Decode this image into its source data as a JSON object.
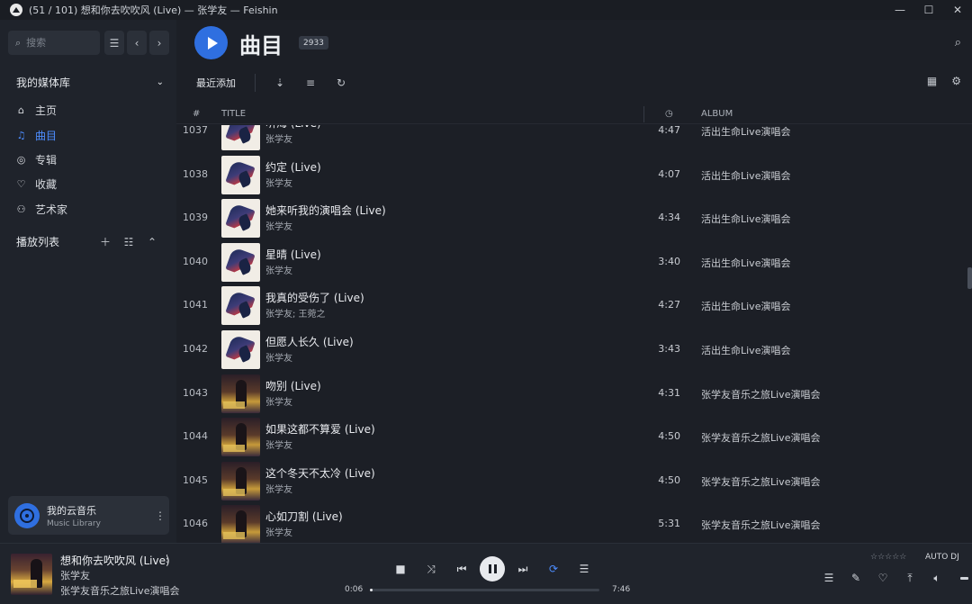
{
  "window": {
    "title": "(51 / 101) 想和你去吹吹风 (Live) — 张学友 — Feishin",
    "controls": [
      "—",
      "☐",
      "✕"
    ]
  },
  "sidebar": {
    "search_placeholder": "搜索",
    "library_header": "我的媒体库",
    "nav": [
      {
        "label": "主页",
        "icon": "home-icon",
        "glyph": "⌂",
        "active": false
      },
      {
        "label": "曲目",
        "icon": "music-note-icon",
        "glyph": "♫",
        "active": true
      },
      {
        "label": "专辑",
        "icon": "album-disc-icon",
        "glyph": "◎",
        "active": false
      },
      {
        "label": "收藏",
        "icon": "heart-icon",
        "glyph": "♡",
        "active": false
      },
      {
        "label": "艺术家",
        "icon": "artist-icon",
        "glyph": "⚇",
        "active": false
      }
    ],
    "playlists_header": "播放列表",
    "cloud": {
      "name": "我的云音乐",
      "sub": "Music Library"
    }
  },
  "main": {
    "title": "曲目",
    "count": "2933",
    "sort_label": "最近添加",
    "columns": {
      "num": "#",
      "title": "TITLE",
      "album": "ALBUM"
    },
    "tracks": [
      {
        "num": "1037",
        "title": "听海 (Live)",
        "artist": "张学友",
        "duration": "4:47",
        "album": "活出生命Live演唱会",
        "cover": "bird"
      },
      {
        "num": "1038",
        "title": "约定 (Live)",
        "artist": "张学友",
        "duration": "4:07",
        "album": "活出生命Live演唱会",
        "cover": "bird"
      },
      {
        "num": "1039",
        "title": "她来听我的演唱会 (Live)",
        "artist": "张学友",
        "duration": "4:34",
        "album": "活出生命Live演唱会",
        "cover": "bird"
      },
      {
        "num": "1040",
        "title": "星晴 (Live)",
        "artist": "张学友",
        "duration": "3:40",
        "album": "活出生命Live演唱会",
        "cover": "bird"
      },
      {
        "num": "1041",
        "title": "我真的受伤了 (Live)",
        "artist": "张学友; 王菀之",
        "duration": "4:27",
        "album": "活出生命Live演唱会",
        "cover": "bird"
      },
      {
        "num": "1042",
        "title": "但愿人长久 (Live)",
        "artist": "张学友",
        "duration": "3:43",
        "album": "活出生命Live演唱会",
        "cover": "bird"
      },
      {
        "num": "1043",
        "title": "吻别 (Live)",
        "artist": "张学友",
        "duration": "4:31",
        "album": "张学友音乐之旅Live演唱会",
        "cover": "concert"
      },
      {
        "num": "1044",
        "title": "如果这都不算爱 (Live)",
        "artist": "张学友",
        "duration": "4:50",
        "album": "张学友音乐之旅Live演唱会",
        "cover": "concert"
      },
      {
        "num": "1045",
        "title": "这个冬天不太冷 (Live)",
        "artist": "张学友",
        "duration": "4:50",
        "album": "张学友音乐之旅Live演唱会",
        "cover": "concert"
      },
      {
        "num": "1046",
        "title": "心如刀割 (Live)",
        "artist": "张学友",
        "duration": "5:31",
        "album": "张学友音乐之旅Live演唱会",
        "cover": "concert"
      }
    ]
  },
  "player": {
    "title": "想和你去吹吹风 (Live)",
    "artist": "张学友",
    "album": "张学友音乐之旅Live演唱会",
    "current_time": "0:06",
    "total_time": "7:46",
    "progress_fraction": 0.013,
    "rating": "☆☆☆☆☆",
    "auto_dj": "AUTO DJ"
  },
  "colors": {
    "accent": "#2f6fe0",
    "active_nav": "#4d8dff",
    "background": "#1c1f26",
    "sidebar": "#1f232b"
  }
}
